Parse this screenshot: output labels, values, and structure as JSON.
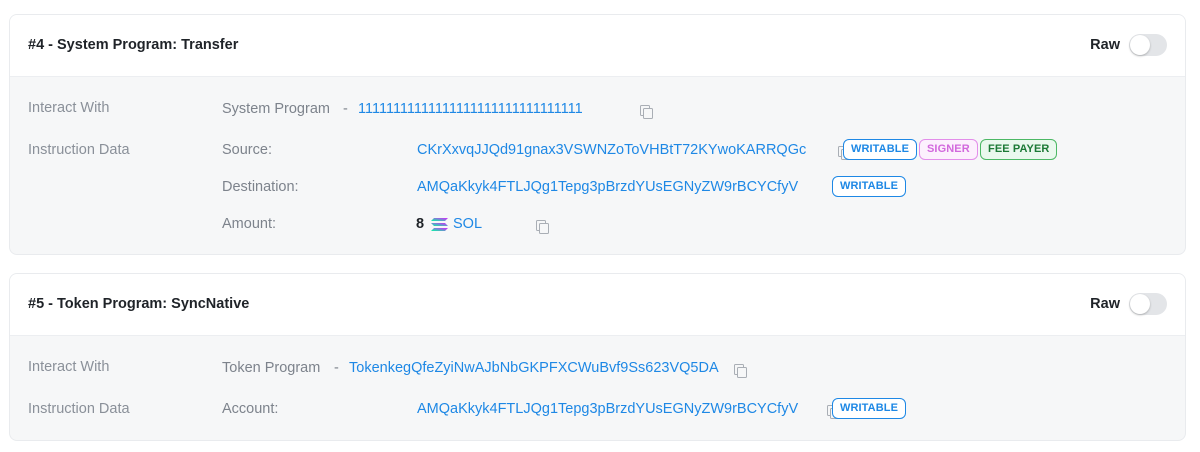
{
  "instructions": [
    {
      "title": "#4 - System Program: Transfer",
      "raw_label": "Raw",
      "interact_label": "Interact With",
      "program_name": "System Program",
      "program_separator": "-",
      "program_address": "11111111111111111111111111111111",
      "data_label": "Instruction Data",
      "source_label": "Source:",
      "source_address": "CKrXxvqJJQd91gnax3VSWNZoToVHBtT72KYwoKARRQGc",
      "badge_writable": "WRITABLE",
      "badge_signer": "SIGNER",
      "badge_fee_payer": "FEE PAYER",
      "destination_label": "Destination:",
      "destination_address": "AMQaKkyk4FTLJQg1Tepg3pBrzdYUsEGNyZW9rBCYCfyV",
      "destination_badge": "WRITABLE",
      "amount_label": "Amount:",
      "amount_value": "8",
      "amount_token": "SOL",
      "token_icon": "solana-logo-icon"
    },
    {
      "title": "#5 - Token Program: SyncNative",
      "raw_label": "Raw",
      "interact_label": "Interact With",
      "program_name": "Token Program",
      "program_separator": "-",
      "program_address": "TokenkegQfeZyiNwAJbNbGKPFXCWuBvf9Ss623VQ5DA",
      "data_label": "Instruction Data",
      "account_label": "Account:",
      "account_address": "AMQaKkyk4FTLJQg1Tepg3pBrzdYUsEGNyZW9rBCYCfyV",
      "account_badge": "WRITABLE"
    }
  ],
  "colors": {
    "link": "#1e88e5",
    "card_body": "#f6f7f8",
    "signer": "#d268dd",
    "fee_payer": "#1c7a36"
  }
}
